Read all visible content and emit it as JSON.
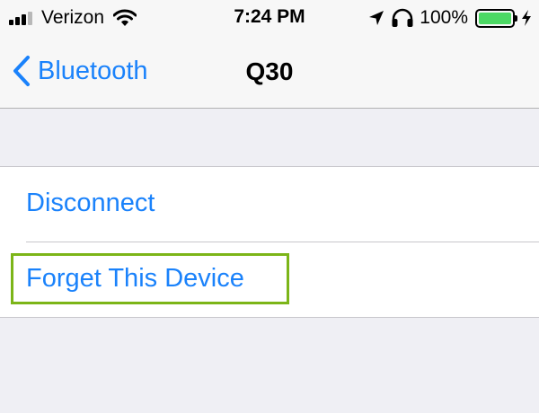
{
  "status_bar": {
    "carrier": "Verizon",
    "time": "7:24 PM",
    "battery_percent": "100%",
    "battery_level": 1.0,
    "signal_bars_filled": 3,
    "signal_bars_total": 4,
    "icons": [
      "signal-bars-icon",
      "wifi-icon",
      "location-arrow-icon",
      "headphones-icon",
      "battery-icon",
      "charging-bolt-icon"
    ]
  },
  "nav": {
    "back_label": "Bluetooth",
    "title": "Q30"
  },
  "actions": {
    "disconnect_label": "Disconnect",
    "forget_label": "Forget This Device"
  },
  "colors": {
    "ios_blue": "#1a82fb",
    "background": "#efeff4",
    "bar_background": "#f7f7f7",
    "battery_green": "#4cd964",
    "highlight_green": "#7cb518"
  }
}
